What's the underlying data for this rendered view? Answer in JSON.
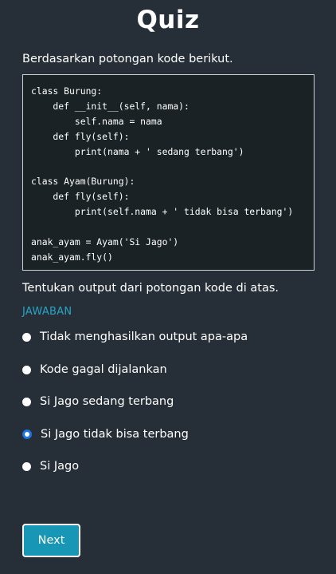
{
  "quiz": {
    "title": "Quiz",
    "prompt": "Berdasarkan potongan kode berikut.",
    "code": "class Burung:\n    def __init__(self, nama):\n        self.nama = nama\n    def fly(self):\n        print(nama + ' sedang terbang')\n\nclass Ayam(Burung):\n    def fly(self):\n        print(self.nama + ' tidak bisa terbang')\n\nanak_ayam = Ayam('Si Jago')\nanak_ayam.fly()",
    "question": "Tentukan output dari potongan kode di atas.",
    "answer_label": "JAWABAN",
    "options": [
      {
        "label": "Tidak menghasilkan output apa-apa",
        "selected": false
      },
      {
        "label": "Kode gagal dijalankan",
        "selected": false
      },
      {
        "label": "Si Jago sedang terbang",
        "selected": false
      },
      {
        "label": "Si Jago tidak bisa terbang",
        "selected": true
      },
      {
        "label": "Si Jago",
        "selected": false
      }
    ],
    "next_label": "Next"
  },
  "colors": {
    "background": "#262f38",
    "code_background": "#1a2226",
    "accent": "#2aa4c4",
    "button": "#1796b5",
    "radio_selected": "#1a73e8"
  }
}
